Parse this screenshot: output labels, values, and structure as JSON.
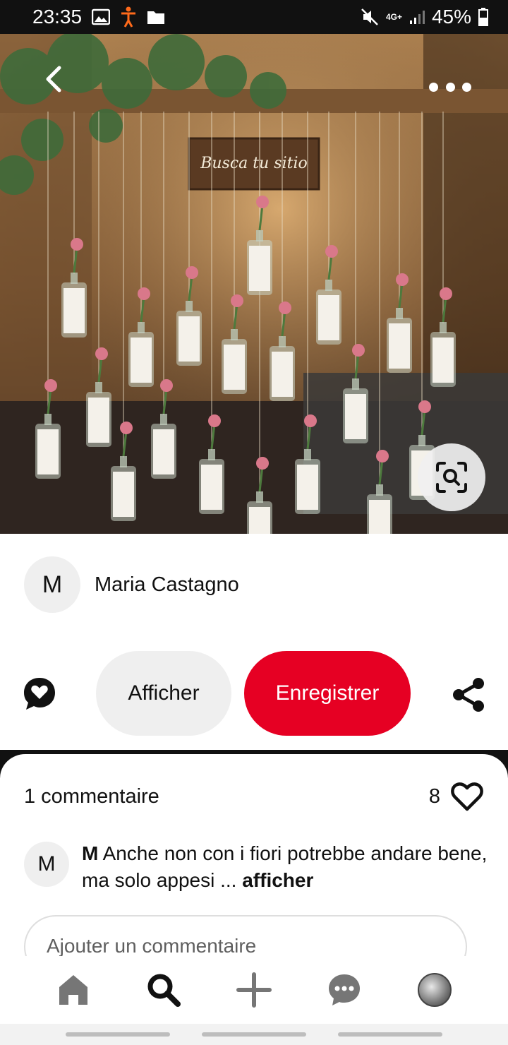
{
  "status_bar": {
    "time": "23:35",
    "network": "4G+",
    "battery": "45%"
  },
  "hero": {
    "sign_text": "Busca tu sitio"
  },
  "author": {
    "initial": "M",
    "name": "Maria Castagno"
  },
  "actions": {
    "view_label": "Afficher",
    "save_label": "Enregistrer"
  },
  "comments": {
    "count_label": "1 commentaire",
    "likes": "8",
    "items": [
      {
        "initial": "M",
        "author": "M",
        "text": "Anche non con i fiori potrebbe andare bene, ma solo appesi ...",
        "more_label": "afficher"
      }
    ],
    "add_placeholder": "Ajouter un commentaire"
  },
  "colors": {
    "brand_red": "#e60023",
    "button_gray": "#efefef",
    "status_bar": "#111111"
  },
  "icons": {
    "back": "chevron-left-icon",
    "more": "more-horizontal-icon",
    "lens": "visual-search-icon",
    "comment": "speech-bubble-heart-icon",
    "share": "share-icon",
    "like": "heart-outline-icon",
    "nav": [
      "home-icon",
      "search-icon",
      "plus-icon",
      "chat-icon",
      "profile-avatar"
    ]
  }
}
